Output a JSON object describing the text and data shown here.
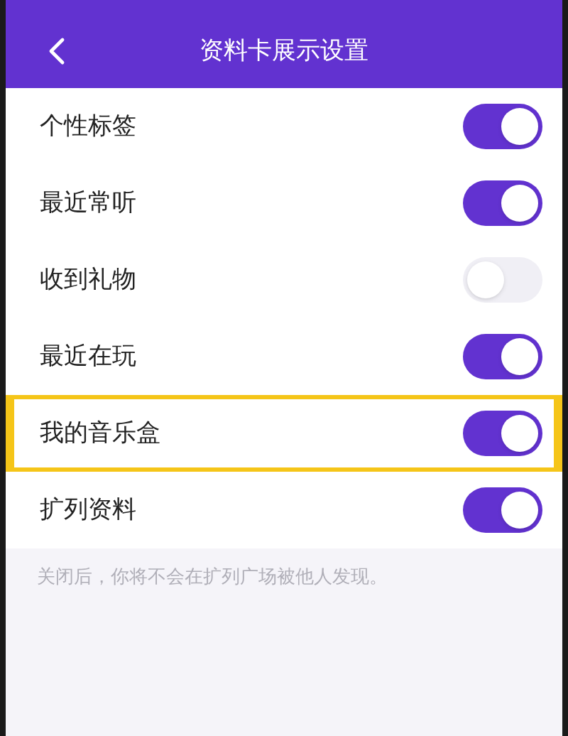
{
  "nav_bar": {
    "title": "资料卡展示设置"
  },
  "settings": [
    {
      "label": "个性标签",
      "on": true,
      "highlighted": false
    },
    {
      "label": "最近常听",
      "on": true,
      "highlighted": false
    },
    {
      "label": "收到礼物",
      "on": false,
      "highlighted": false
    },
    {
      "label": "最近在玩",
      "on": true,
      "highlighted": false
    },
    {
      "label": "我的音乐盒",
      "on": true,
      "highlighted": true
    },
    {
      "label": "扩列资料",
      "on": true,
      "highlighted": false
    }
  ],
  "footer_note": "关闭后，你将不会在扩列广场被他人发现。"
}
